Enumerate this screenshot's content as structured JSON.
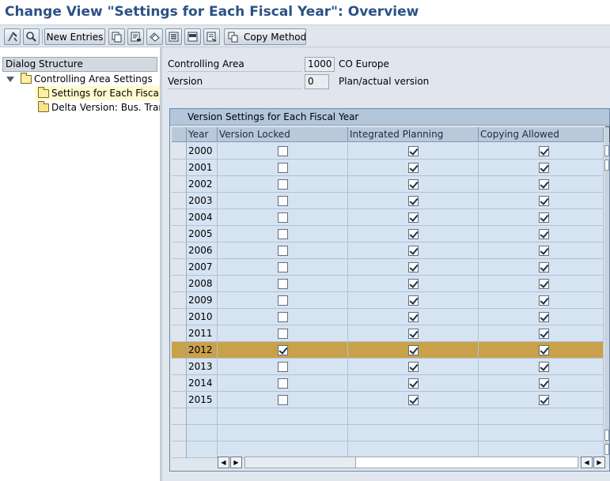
{
  "window": {
    "title": "Change View \"Settings for Each Fiscal Year\": Overview"
  },
  "toolbar": {
    "icons": [
      "other-view-icon",
      "find-icon",
      "copy-icon",
      "delete-icon",
      "undo-icon",
      "select-all-icon",
      "select-block-icon",
      "deselect-icon",
      "copy-method-icon"
    ],
    "new_entries_label": "New Entries",
    "copy_method_label": "Copy Method"
  },
  "dialog_structure": {
    "header": "Dialog Structure",
    "items": [
      {
        "label": "Controlling Area Settings",
        "level": 0,
        "expanded": true,
        "selected": false
      },
      {
        "label": "Settings for Each Fiscal Year",
        "level": 1,
        "selected": true
      },
      {
        "label": "Delta Version: Bus. Transactions",
        "level": 1,
        "selected": false
      }
    ]
  },
  "header_fields": {
    "controlling_area": {
      "label": "Controlling Area",
      "value": "1000",
      "desc": "CO Europe"
    },
    "version": {
      "label": "Version",
      "value": "0",
      "desc": "Plan/actual version"
    }
  },
  "table": {
    "title": "Version Settings for Each Fiscal Year",
    "columns": [
      "Year",
      "Version Locked",
      "Integrated Planning",
      "Copying Allowed"
    ],
    "rows": [
      {
        "year": "2000",
        "locked": false,
        "integrated": true,
        "copying": true
      },
      {
        "year": "2001",
        "locked": false,
        "integrated": true,
        "copying": true
      },
      {
        "year": "2002",
        "locked": false,
        "integrated": true,
        "copying": true
      },
      {
        "year": "2003",
        "locked": false,
        "integrated": true,
        "copying": true
      },
      {
        "year": "2004",
        "locked": false,
        "integrated": true,
        "copying": true
      },
      {
        "year": "2005",
        "locked": false,
        "integrated": true,
        "copying": true
      },
      {
        "year": "2006",
        "locked": false,
        "integrated": true,
        "copying": true
      },
      {
        "year": "2007",
        "locked": false,
        "integrated": true,
        "copying": true
      },
      {
        "year": "2008",
        "locked": false,
        "integrated": true,
        "copying": true
      },
      {
        "year": "2009",
        "locked": false,
        "integrated": true,
        "copying": true
      },
      {
        "year": "2010",
        "locked": false,
        "integrated": true,
        "copying": true
      },
      {
        "year": "2011",
        "locked": false,
        "integrated": true,
        "copying": true
      },
      {
        "year": "2012",
        "locked": true,
        "integrated": true,
        "copying": true,
        "highlighted": true
      },
      {
        "year": "2013",
        "locked": false,
        "integrated": true,
        "copying": true
      },
      {
        "year": "2014",
        "locked": false,
        "integrated": true,
        "copying": true
      },
      {
        "year": "2015",
        "locked": false,
        "integrated": true,
        "copying": true
      }
    ],
    "empty_rows": 3
  },
  "colors": {
    "title": "#2a5285",
    "highlight_row": "#c8a14a",
    "selected_tree_item": "#fffbcf"
  }
}
